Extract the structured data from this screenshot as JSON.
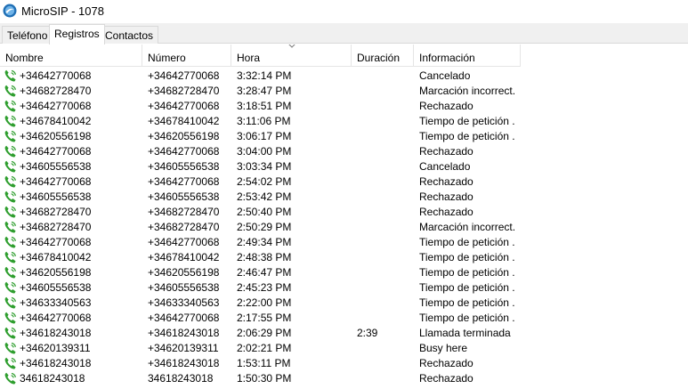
{
  "window": {
    "title": "MicroSIP - 1078"
  },
  "tabs": [
    {
      "label": "Teléfono",
      "active": false
    },
    {
      "label": "Registros",
      "active": true
    },
    {
      "label": "Contactos",
      "active": false
    }
  ],
  "columns": {
    "name": "Nombre",
    "number": "Número",
    "time": "Hora",
    "duration": "Duración",
    "info": "Información"
  },
  "sort": {
    "column": "time",
    "direction": "descending"
  },
  "icons": {
    "app": "microsip-logo-icon",
    "call": "phone-call-icon"
  },
  "colors": {
    "phone_icon": "#2e9e2e",
    "tab_border": "#d9d9d9",
    "tabstrip_bg": "#f0f0f0"
  },
  "rows": [
    {
      "name": "+34642770068",
      "number": "+34642770068",
      "time": "3:32:14 PM",
      "duration": "",
      "info": "Cancelado"
    },
    {
      "name": "+34682728470",
      "number": "+34682728470",
      "time": "3:28:47 PM",
      "duration": "",
      "info": "Marcación incorrect..."
    },
    {
      "name": "+34642770068",
      "number": "+34642770068",
      "time": "3:18:51 PM",
      "duration": "",
      "info": "Rechazado"
    },
    {
      "name": "+34678410042",
      "number": "+34678410042",
      "time": "3:11:06 PM",
      "duration": "",
      "info": "Tiempo de petición ..."
    },
    {
      "name": "+34620556198",
      "number": "+34620556198",
      "time": "3:06:17 PM",
      "duration": "",
      "info": "Tiempo de petición ..."
    },
    {
      "name": "+34642770068",
      "number": "+34642770068",
      "time": "3:04:00 PM",
      "duration": "",
      "info": "Rechazado"
    },
    {
      "name": "+34605556538",
      "number": "+34605556538",
      "time": "3:03:34 PM",
      "duration": "",
      "info": "Cancelado"
    },
    {
      "name": "+34642770068",
      "number": "+34642770068",
      "time": "2:54:02 PM",
      "duration": "",
      "info": "Rechazado"
    },
    {
      "name": "+34605556538",
      "number": "+34605556538",
      "time": "2:53:42 PM",
      "duration": "",
      "info": "Rechazado"
    },
    {
      "name": "+34682728470",
      "number": "+34682728470",
      "time": "2:50:40 PM",
      "duration": "",
      "info": "Rechazado"
    },
    {
      "name": "+34682728470",
      "number": "+34682728470",
      "time": "2:50:29 PM",
      "duration": "",
      "info": "Marcación incorrect..."
    },
    {
      "name": "+34642770068",
      "number": "+34642770068",
      "time": "2:49:34 PM",
      "duration": "",
      "info": "Tiempo de petición ..."
    },
    {
      "name": "+34678410042",
      "number": "+34678410042",
      "time": "2:48:38 PM",
      "duration": "",
      "info": "Tiempo de petición ..."
    },
    {
      "name": "+34620556198",
      "number": "+34620556198",
      "time": "2:46:47 PM",
      "duration": "",
      "info": "Tiempo de petición ..."
    },
    {
      "name": "+34605556538",
      "number": "+34605556538",
      "time": "2:45:23 PM",
      "duration": "",
      "info": "Tiempo de petición ..."
    },
    {
      "name": "+34633340563",
      "number": "+34633340563",
      "time": "2:22:00 PM",
      "duration": "",
      "info": "Tiempo de petición ..."
    },
    {
      "name": "+34642770068",
      "number": "+34642770068",
      "time": "2:17:55 PM",
      "duration": "",
      "info": "Tiempo de petición ..."
    },
    {
      "name": "+34618243018",
      "number": "+34618243018",
      "time": "2:06:29 PM",
      "duration": "2:39",
      "info": "Llamada terminada"
    },
    {
      "name": "+34620139311",
      "number": "+34620139311",
      "time": "2:02:21 PM",
      "duration": "",
      "info": "Busy here"
    },
    {
      "name": "+34618243018",
      "number": "+34618243018",
      "time": "1:53:11 PM",
      "duration": "",
      "info": "Rechazado"
    },
    {
      "name": "34618243018",
      "number": "34618243018",
      "time": "1:50:30 PM",
      "duration": "",
      "info": "Rechazado"
    }
  ]
}
